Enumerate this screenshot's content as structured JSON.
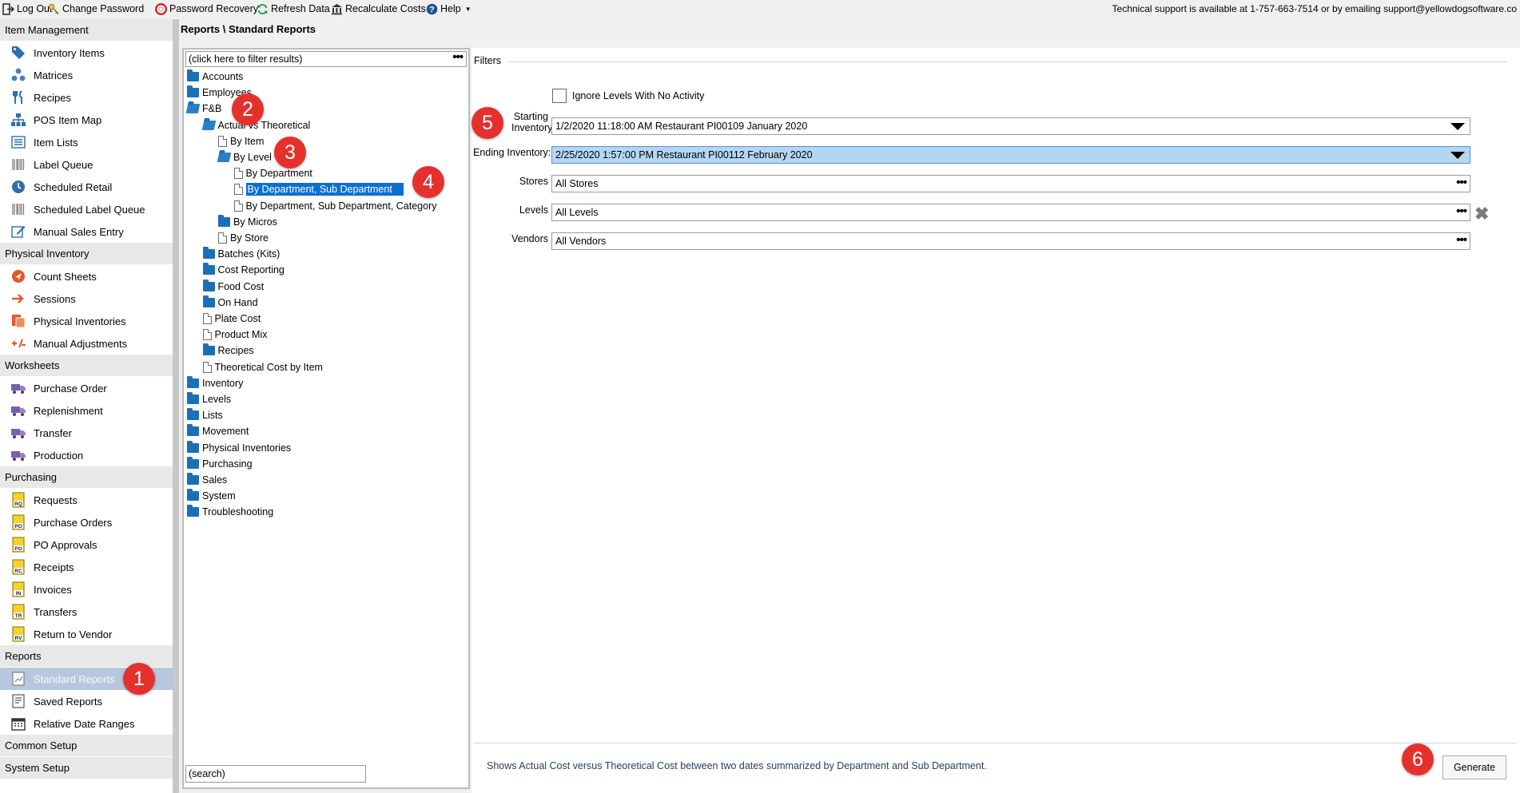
{
  "toolbar": {
    "items": [
      {
        "label": "Log Out",
        "icon": "logout-icon"
      },
      {
        "label": "Change Password",
        "icon": "key-icon"
      },
      {
        "label": "Password Recovery",
        "icon": "lifebuoy-icon"
      },
      {
        "label": "Refresh Data",
        "icon": "refresh-icon"
      },
      {
        "label": "Recalculate Costs",
        "icon": "bank-icon"
      },
      {
        "label": "Help",
        "icon": "help-icon"
      }
    ],
    "support_text": "Technical support is available at 1-757-663-7514 or by emailing support@yellowdogsoftware.co"
  },
  "nav": {
    "sections": [
      {
        "title": "Item Management",
        "items": [
          {
            "label": "Inventory Items",
            "icon": "tag-icon"
          },
          {
            "label": "Matrices",
            "icon": "matrix-icon"
          },
          {
            "label": "Recipes",
            "icon": "utensils-icon"
          },
          {
            "label": "POS Item Map",
            "icon": "sitemap-icon"
          },
          {
            "label": "Item Lists",
            "icon": "list-icon"
          },
          {
            "label": "Label Queue",
            "icon": "barcode-icon"
          },
          {
            "label": "Scheduled Retail",
            "icon": "clock-icon"
          },
          {
            "label": "Scheduled Label Queue",
            "icon": "barcode-icon"
          },
          {
            "label": "Manual Sales Entry",
            "icon": "edit-icon"
          }
        ]
      },
      {
        "title": "Physical Inventory",
        "items": [
          {
            "label": "Count Sheets",
            "icon": "count-sheet-icon"
          },
          {
            "label": "Sessions",
            "icon": "session-icon"
          },
          {
            "label": "Physical Inventories",
            "icon": "inventories-icon"
          },
          {
            "label": "Manual Adjustments",
            "icon": "plus-minus-icon"
          }
        ]
      },
      {
        "title": "Worksheets",
        "items": [
          {
            "label": "Purchase Order",
            "icon": "truck-icon"
          },
          {
            "label": "Replenishment",
            "icon": "truck-icon"
          },
          {
            "label": "Transfer",
            "icon": "truck-icon"
          },
          {
            "label": "Production",
            "icon": "truck-icon"
          }
        ]
      },
      {
        "title": "Purchasing",
        "items": [
          {
            "label": "Requests",
            "icon": "doc-rq-icon",
            "badge": "RQ"
          },
          {
            "label": "Purchase Orders",
            "icon": "doc-po-icon",
            "badge": "PO"
          },
          {
            "label": "PO Approvals",
            "icon": "doc-po-approval-icon",
            "badge": "PO"
          },
          {
            "label": "Receipts",
            "icon": "doc-rc-icon",
            "badge": "RC"
          },
          {
            "label": "Invoices",
            "icon": "doc-in-icon",
            "badge": "IN"
          },
          {
            "label": "Transfers",
            "icon": "doc-tr-icon",
            "badge": "TR"
          },
          {
            "label": "Return to Vendor",
            "icon": "doc-rv-icon",
            "badge": "RV"
          }
        ]
      },
      {
        "title": "Reports",
        "items": [
          {
            "label": "Standard Reports",
            "icon": "report-icon",
            "selected": true
          },
          {
            "label": "Saved Reports",
            "icon": "saved-report-icon"
          },
          {
            "label": "Relative Date Ranges",
            "icon": "calendar-icon"
          }
        ]
      },
      {
        "title": "Common Setup",
        "items": []
      },
      {
        "title": "System Setup",
        "items": []
      }
    ]
  },
  "breadcrumb": "Reports \\ Standard Reports",
  "tree": {
    "filter_placeholder": "(click here to filter results)",
    "search_placeholder": "(search)",
    "nodes": [
      {
        "label": "Accounts",
        "type": "folder",
        "level": 0
      },
      {
        "label": "Employees",
        "type": "folder",
        "level": 0
      },
      {
        "label": "F&B",
        "type": "folder-open",
        "level": 0
      },
      {
        "label": "Actual vs Theoretical",
        "type": "folder-open",
        "level": 1
      },
      {
        "label": "By Item",
        "type": "report",
        "level": 2
      },
      {
        "label": "By Level",
        "type": "folder-open",
        "level": 2
      },
      {
        "label": "By Department",
        "type": "report",
        "level": 3
      },
      {
        "label": "By Department, Sub Department",
        "type": "report",
        "level": 3,
        "selected": true
      },
      {
        "label": "By Department, Sub Department, Category",
        "type": "report",
        "level": 3
      },
      {
        "label": "By Micros",
        "type": "folder",
        "level": 2
      },
      {
        "label": "By Store",
        "type": "report",
        "level": 2
      },
      {
        "label": "Batches (Kits)",
        "type": "folder",
        "level": 1
      },
      {
        "label": "Cost Reporting",
        "type": "folder",
        "level": 1
      },
      {
        "label": "Food Cost",
        "type": "folder",
        "level": 1
      },
      {
        "label": "On Hand",
        "type": "folder",
        "level": 1
      },
      {
        "label": "Plate Cost",
        "type": "report",
        "level": 1
      },
      {
        "label": "Product Mix",
        "type": "report",
        "level": 1
      },
      {
        "label": "Recipes",
        "type": "folder",
        "level": 1
      },
      {
        "label": "Theoretical Cost by Item",
        "type": "report",
        "level": 1
      },
      {
        "label": "Inventory",
        "type": "folder",
        "level": 0
      },
      {
        "label": "Levels",
        "type": "folder",
        "level": 0
      },
      {
        "label": "Lists",
        "type": "folder",
        "level": 0
      },
      {
        "label": "Movement",
        "type": "folder",
        "level": 0
      },
      {
        "label": "Physical Inventories",
        "type": "folder",
        "level": 0
      },
      {
        "label": "Purchasing",
        "type": "folder",
        "level": 0
      },
      {
        "label": "Sales",
        "type": "folder",
        "level": 0
      },
      {
        "label": "System",
        "type": "folder",
        "level": 0
      },
      {
        "label": "Troubleshooting",
        "type": "folder",
        "level": 0
      }
    ]
  },
  "filters": {
    "title": "Filters",
    "ignore_levels_label": "Ignore Levels With No Activity",
    "ignore_levels_checked": false,
    "starting_label_line1": "Starting",
    "starting_label_line2": "Inventory:",
    "starting_value": "1/2/2020 11:18:00 AM Restaurant PI00109 January 2020",
    "ending_label": "Ending Inventory:",
    "ending_value": "2/25/2020 1:57:00 PM Restaurant PI00112 February 2020",
    "stores_label": "Stores",
    "stores_value": "All Stores",
    "levels_label": "Levels",
    "levels_value": "All Levels",
    "vendors_label": "Vendors",
    "vendors_value": "All Vendors"
  },
  "footer": {
    "description": "Shows Actual Cost versus Theoretical Cost between two dates summarized by Department and Sub Department.",
    "generate_label": "Generate"
  },
  "callouts": [
    "1",
    "2",
    "3",
    "4",
    "5",
    "6"
  ],
  "colors": {
    "accent": "#0a6fd3",
    "callout": "#e5312e",
    "folder": "#1b6fb8",
    "selected_nav": "#b7c8de",
    "highlight_field": "#b3d7f3"
  }
}
